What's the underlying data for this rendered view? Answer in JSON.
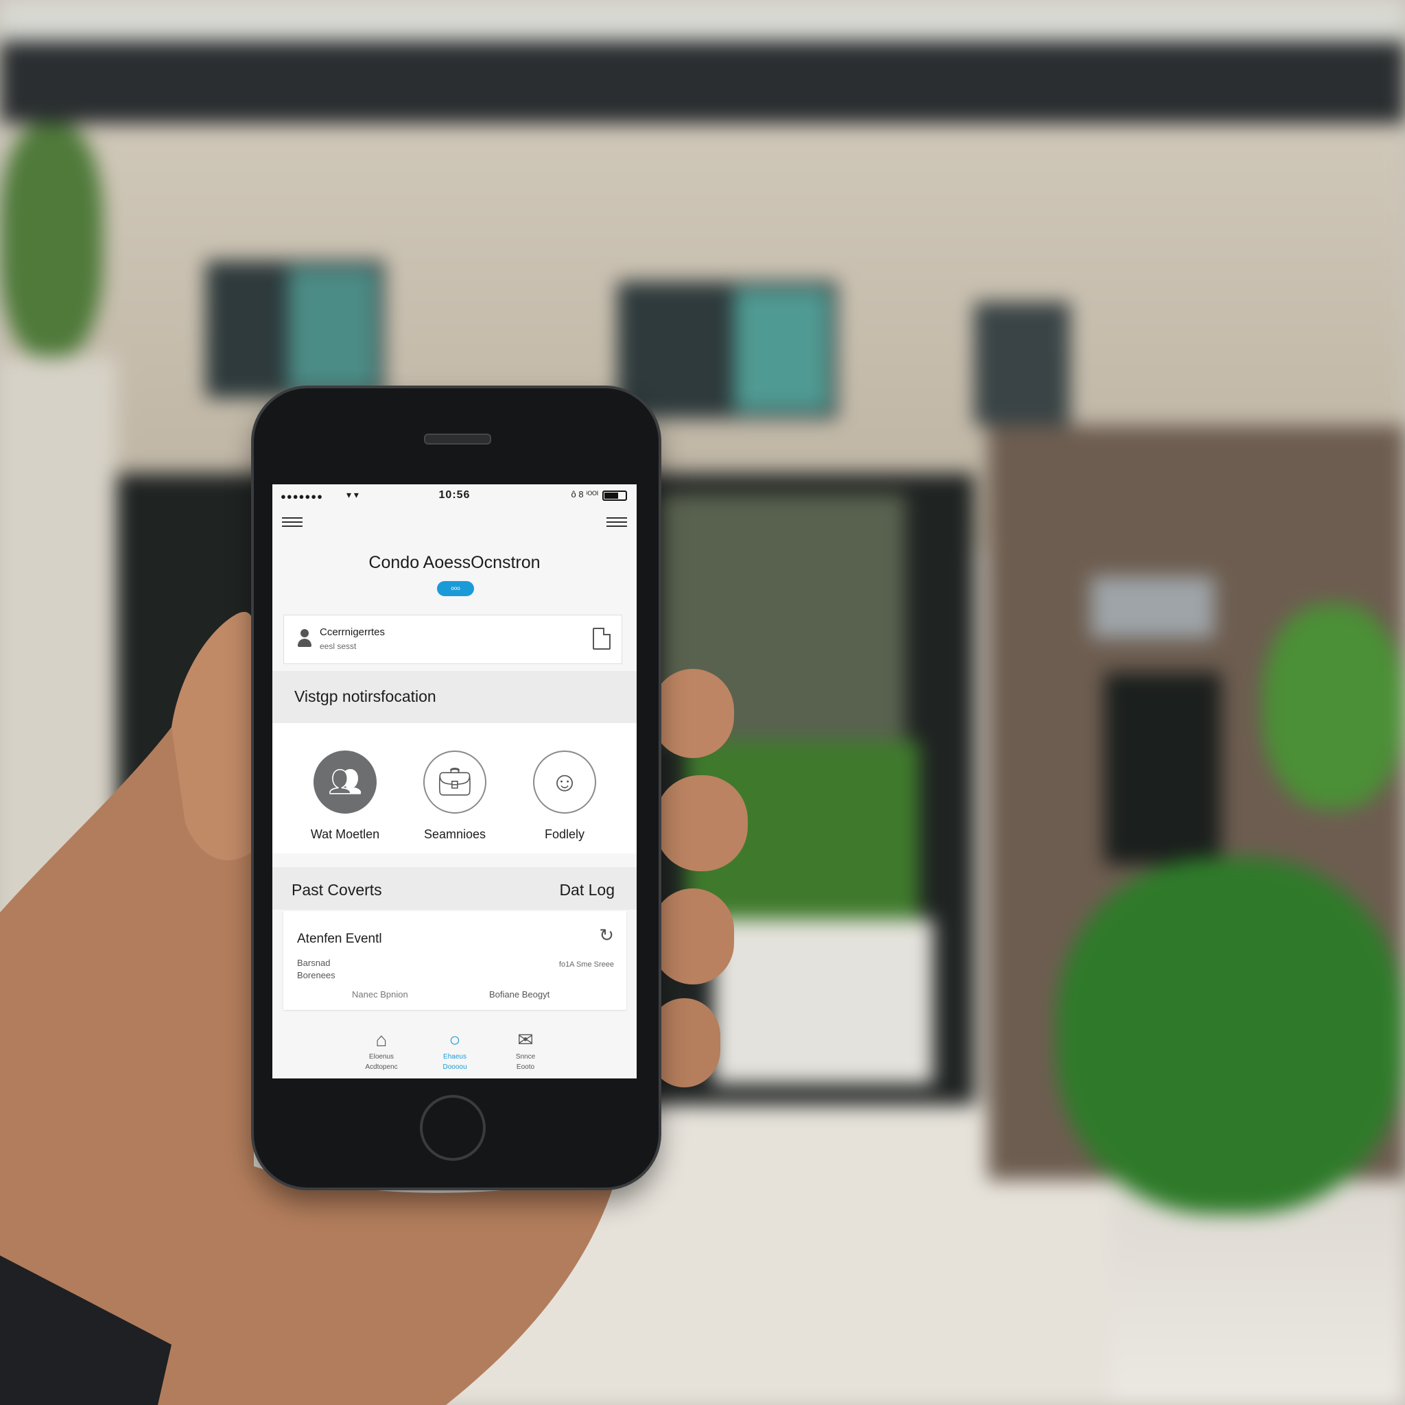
{
  "status_bar": {
    "signal": "●●●●●●●",
    "wifi": "▾ ▾",
    "time": "10:56",
    "right": "ô 8 ⁱᴼᴼᴵ"
  },
  "header": {
    "title": "Condo AoessOcnstron",
    "badge": "ooo"
  },
  "info_card": {
    "title": "Ccerrnigerrtes",
    "subtitle": "eesl sesst"
  },
  "visitor_section": {
    "heading": "Vistgp notirsfocation",
    "shortcuts": [
      {
        "label": "Wat Moetlen",
        "icon": "group-icon"
      },
      {
        "label": "Seamnioes",
        "icon": "luggage-icon"
      },
      {
        "label": "Fodlely",
        "icon": "person-circle-icon"
      }
    ]
  },
  "events_section": {
    "heading": "Past Coverts",
    "link": "Dat Log",
    "card": {
      "title": "Atenfen Eventl",
      "line1": "Barsnad",
      "line2": "Borenees",
      "right": "fo1A Sme Sreee",
      "footer_left": "Nanec Bpnion",
      "footer_right": "Bofiane Beogyt"
    }
  },
  "tab_bar": {
    "items": [
      {
        "label1": "Eloenus",
        "label2": "Acdtopenc",
        "icon": "home-icon"
      },
      {
        "label1": "Ehaeus",
        "label2": "Doooou",
        "icon": "chat-icon"
      },
      {
        "label1": "Snnce",
        "label2": "Eooto",
        "icon": "mail-icon"
      }
    ]
  },
  "colors": {
    "accent": "#1a9bd8",
    "screen_bg": "#f6f6f6",
    "section_bg": "#ebebeb",
    "phone_body": "#151617"
  }
}
